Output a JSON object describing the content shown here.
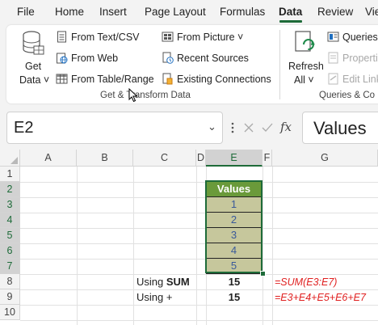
{
  "menu": {
    "tabs": [
      "File",
      "Home",
      "Insert",
      "Page Layout",
      "Formulas",
      "Data",
      "Review",
      "Vie"
    ],
    "active": "Data"
  },
  "ribbon": {
    "get_data": {
      "line1": "Get",
      "line2": "Data ˅"
    },
    "from_text_csv": "From Text/CSV",
    "from_web": "From Web",
    "from_table_range": "From Table/Range",
    "from_picture": "From Picture ˅",
    "recent_sources": "Recent Sources",
    "existing_connections": "Existing Connections",
    "group1_label": "Get & Transform Data",
    "refresh_all": {
      "line1": "Refresh",
      "line2": "All ˅"
    },
    "queries": "Queries",
    "properties": "Properti",
    "edit_links": "Edit Link",
    "group2_label": "Queries & Co"
  },
  "formula_bar": {
    "name_box": "E2",
    "formula": "Values",
    "fx_label": "fx"
  },
  "sheet": {
    "columns": [
      "A",
      "B",
      "C",
      "D",
      "E",
      "F",
      "G"
    ],
    "rows": [
      "1",
      "2",
      "3",
      "4",
      "5",
      "6",
      "7",
      "8",
      "9",
      "10"
    ],
    "selected_column": "E",
    "values_header": "Values",
    "values": [
      "1",
      "2",
      "3",
      "4",
      "5"
    ],
    "row8": {
      "label_prefix": "Using ",
      "label_bold": "SUM",
      "result": "15",
      "formula": "=SUM(E3:E7)"
    },
    "row9": {
      "label": "Using +",
      "result": "15",
      "formula": "=E3+E4+E5+E6+E7"
    }
  }
}
